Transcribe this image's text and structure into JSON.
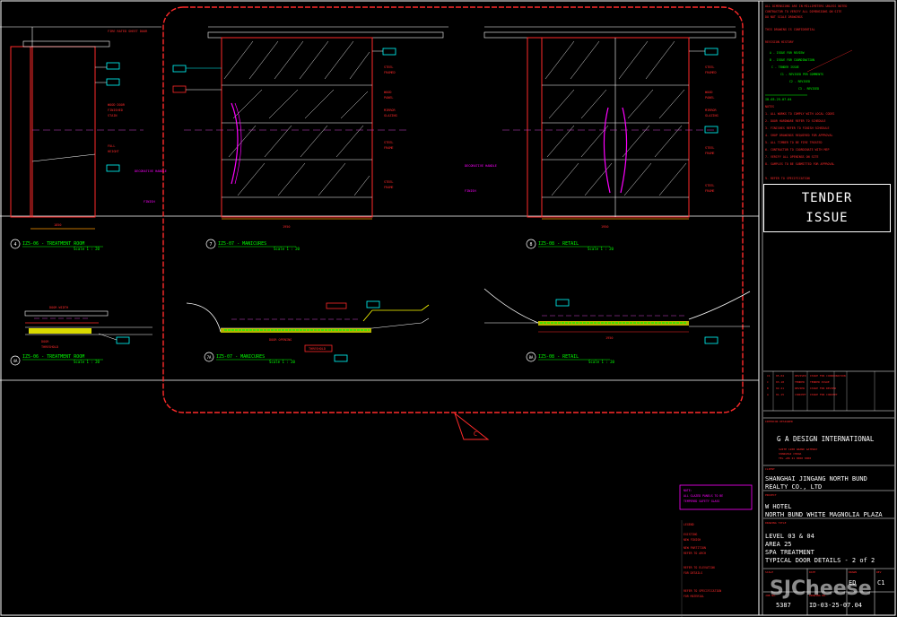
{
  "drawing": {
    "views": [
      {
        "tag": "IZ5-06 - TREATMENT ROOM",
        "scale": "Scale 1 : 20"
      },
      {
        "tag": "IZ5-07 - MANICURES",
        "scale": "Scale 1 : 20"
      },
      {
        "tag": "IZ5-08 - RETAIL",
        "scale": "Scale 1 : 20"
      },
      {
        "tag": "IZ5-06 - TREATMENT ROOM",
        "scale": "Scale 1 : 20"
      },
      {
        "tag": "IZ5-07 - MANICURES",
        "scale": "Scale 1 : 20"
      },
      {
        "tag": "IZ5-08 - RETAIL",
        "scale": "Scale 1 : 20"
      }
    ],
    "view_numbers": [
      "4",
      "7",
      "8",
      "4A",
      "7A",
      "8A"
    ],
    "revision_mark": "C"
  },
  "title_block": {
    "tender": [
      "TENDER",
      "ISSUE"
    ],
    "designer": "G A DESIGN INTERNATIONAL",
    "client": [
      "SHANGHAI JINGANG NORTH BUND",
      "REALTY CO., LTD"
    ],
    "project": [
      "W HOTEL",
      "NORTH BUND WHITE MAGNOLIA PLAZA"
    ],
    "drawing_title": [
      "LEVEL 03 & 04",
      "AREA 25",
      "SPA TREATMENT",
      "TYPICAL DOOR DETAILS - 2 of 2"
    ],
    "drawn_by": "ED",
    "job_no": "5387",
    "sheet_no": "ID-03-25-07.04",
    "rev": "C1",
    "watermark": "SJCheese"
  },
  "colors": {
    "white": "#ffffff",
    "red": "#ff2a2a",
    "yellow": "#ffff00",
    "cyan": "#00ffff",
    "magenta": "#ff00ff",
    "green": "#00ff00",
    "orange": "#ff9900",
    "grey": "#8c8c8c"
  }
}
